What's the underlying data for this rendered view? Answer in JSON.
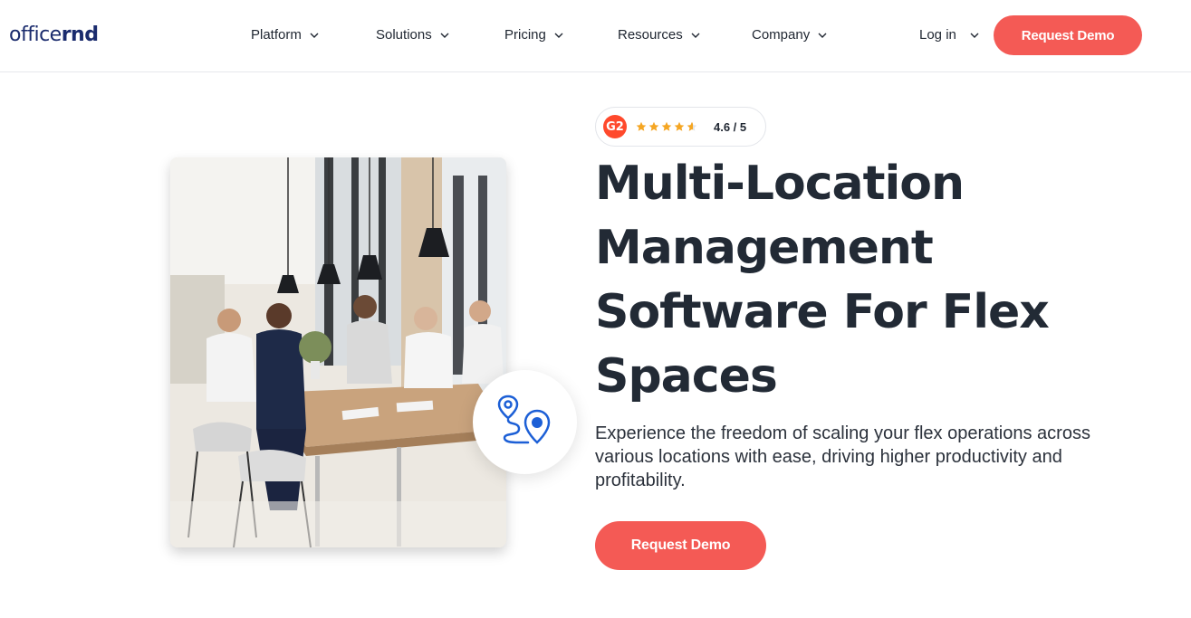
{
  "brand": {
    "name_light": "office",
    "name_bold": "rnd"
  },
  "nav": {
    "items": [
      {
        "label": "Platform"
      },
      {
        "label": "Solutions"
      },
      {
        "label": "Pricing"
      },
      {
        "label": "Resources"
      },
      {
        "label": "Company"
      }
    ],
    "login_label": "Log in",
    "demo_label": "Request Demo"
  },
  "rating": {
    "provider": "G2",
    "stars": 4.6,
    "score_text": "4.6 / 5"
  },
  "hero": {
    "title": "Multi-Location Management Software For Flex Spaces",
    "subtitle": "Experience the freedom of scaling your flex operations across various locations with ease, driving higher productivity and profitability.",
    "cta_label": "Request Demo",
    "badge_icon": "location-route-icon",
    "photo": "people-meeting-at-office-table"
  },
  "colors": {
    "accent": "#f45a55",
    "brand_navy": "#1a2b6d",
    "star": "#f5a623",
    "icon_blue": "#1c5fd6",
    "g2": "#ff492c"
  }
}
